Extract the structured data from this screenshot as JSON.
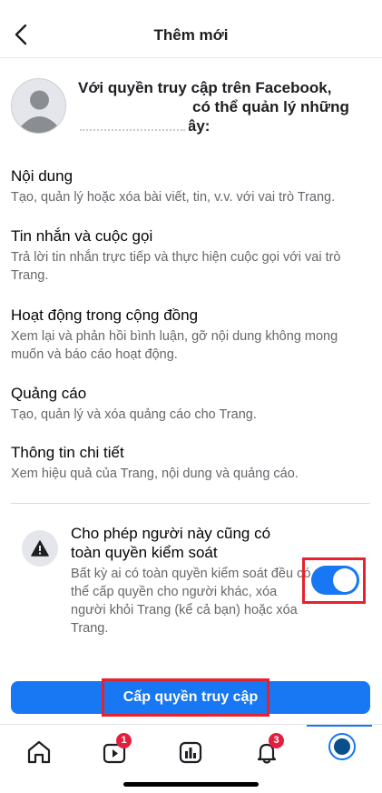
{
  "header": {
    "title": "Thêm mới",
    "back_icon": "chevron-left-icon"
  },
  "intro": {
    "line1": "Với quyền truy cập trên Facebook,",
    "line2": "có thể quản lý những",
    "line3": "nội dung sau đây:"
  },
  "permissions": [
    {
      "title": "Nội dung",
      "desc": "Tạo, quản lý hoặc xóa bài viết, tin, v.v. với vai trò Trang."
    },
    {
      "title": "Tin nhắn và cuộc gọi",
      "desc": "Trả lời tin nhắn trực tiếp và thực hiện cuộc gọi với vai trò Trang."
    },
    {
      "title": "Hoạt động trong cộng đồng",
      "desc": "Xem lại và phản hồi bình luận, gỡ nội dung không mong muốn và báo cáo hoạt động."
    },
    {
      "title": "Quảng cáo",
      "desc": "Tạo, quản lý và xóa quảng cáo cho Trang."
    },
    {
      "title": "Thông tin chi tiết",
      "desc": "Xem hiệu quả của Trang, nội dung và quảng cáo."
    }
  ],
  "full_control": {
    "title": "Cho phép người này cũng có toàn quyền kiểm soát",
    "desc": "Bất kỳ ai có toàn quyền kiểm soát đều có thể cấp quyền cho người khác, xóa người khỏi Trang (kể cả bạn) hoặc xóa Trang.",
    "enabled": true,
    "icon": "warning-icon"
  },
  "grant_button": {
    "label": "Cấp quyền truy cập"
  },
  "tabbar": {
    "tabs": [
      {
        "name": "home",
        "icon": "home-icon"
      },
      {
        "name": "video",
        "icon": "video-icon",
        "badge": "1"
      },
      {
        "name": "insights",
        "icon": "bar-chart-icon"
      },
      {
        "name": "notifications",
        "icon": "bell-icon",
        "badge": "3"
      },
      {
        "name": "profile",
        "icon": "profile-avatar-icon",
        "active": true
      }
    ]
  },
  "colors": {
    "accent": "#1877f2",
    "badge": "#e41e3f",
    "highlight_frame": "#e8212e",
    "secondary_text": "#65676b"
  }
}
